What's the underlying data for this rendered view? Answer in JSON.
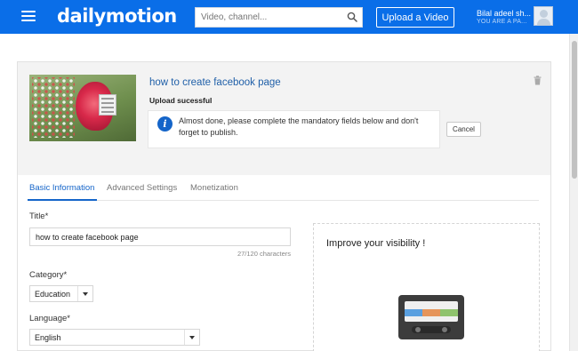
{
  "header": {
    "logo": "dailymotion",
    "search_placeholder": "Video, channel...",
    "upload_label": "Upload a Video",
    "user_name": "Bilal adeel sh...",
    "user_subtitle": "YOU ARE A PA..."
  },
  "video": {
    "title": "how to create facebook page",
    "status": "Upload sucessful",
    "notice": "Almost done, please complete the mandatory fields below and don't forget to publish.",
    "cancel_label": "Cancel"
  },
  "tabs": [
    {
      "label": "Basic Information",
      "active": true
    },
    {
      "label": "Advanced Settings",
      "active": false
    },
    {
      "label": "Monetization",
      "active": false
    }
  ],
  "form": {
    "title_label": "Title*",
    "title_value": "how to create facebook page",
    "char_count": "27/120 characters",
    "category_label": "Category*",
    "category_value": "Education",
    "language_label": "Language*",
    "language_value": "English"
  },
  "visibility": {
    "title": "Improve your visibility !"
  },
  "colors": {
    "brand_blue": "#0a6ee8",
    "link_blue": "#1565c9"
  },
  "icons": [
    "menu-icon",
    "search-icon",
    "avatar",
    "trash-icon",
    "info-icon",
    "cassette-icon"
  ]
}
